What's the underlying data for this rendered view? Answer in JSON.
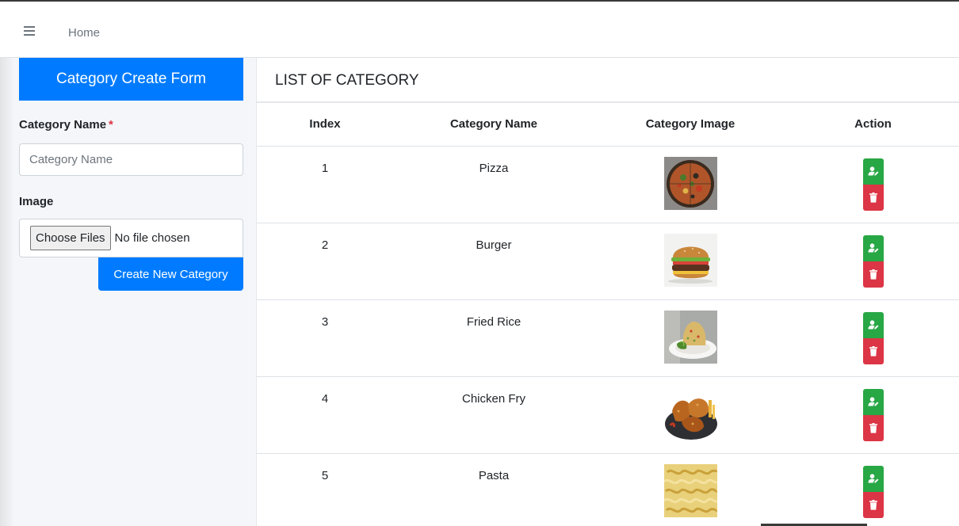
{
  "navbar": {
    "home_label": "Home"
  },
  "form": {
    "header": "Category Create Form",
    "name_label": "Category Name",
    "required_mark": "*",
    "name_placeholder": "Category Name",
    "image_label": "Image",
    "file_button": "Choose Files",
    "file_status": "No file chosen",
    "submit_label": "Create New Category"
  },
  "list": {
    "title": "LIST OF CATEGORY",
    "columns": [
      "Index",
      "Category Name",
      "Category Image",
      "Action"
    ],
    "rows": [
      {
        "index": "1",
        "name": "Pizza",
        "image": "pizza-thumbnail"
      },
      {
        "index": "2",
        "name": "Burger",
        "image": "burger-thumbnail"
      },
      {
        "index": "3",
        "name": "Fried Rice",
        "image": "fried-rice-thumbnail"
      },
      {
        "index": "4",
        "name": "Chicken Fry",
        "image": "chicken-fry-thumbnail"
      },
      {
        "index": "5",
        "name": "Pasta",
        "image": "pasta-thumbnail"
      }
    ]
  },
  "icons": {
    "menu": "hamburger-icon",
    "edit": "user-edit-icon",
    "delete": "trash-icon"
  },
  "colors": {
    "primary": "#007bff",
    "success": "#28a745",
    "danger": "#dc3545"
  }
}
